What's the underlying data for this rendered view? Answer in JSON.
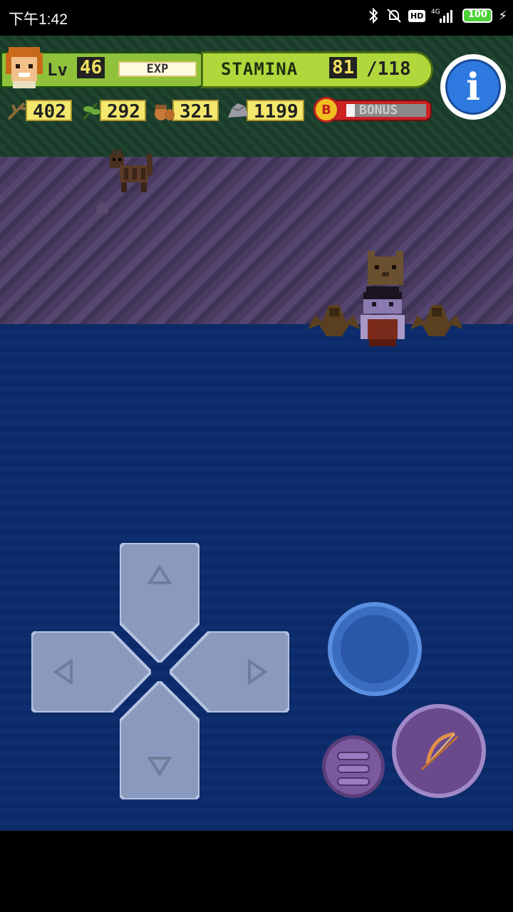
{
  "status_bar": {
    "time": "下午1:42",
    "battery": "100",
    "network": "4G",
    "hd": "HD"
  },
  "hud": {
    "level_label": "Lv",
    "level": "46",
    "exp_label": "EXP",
    "stamina_label": "STAMINA",
    "stamina_current": "81",
    "stamina_separator": "/",
    "stamina_max": "118",
    "info_label": "i",
    "resources": {
      "wood": "402",
      "herb": "292",
      "acorn": "321",
      "stone": "1199"
    },
    "bonus_label": "BONUS",
    "bonus_coin": "B"
  },
  "colors": {
    "ground": "#4a3c60",
    "water": "#0d2a66",
    "accent_blue": "#2f7ae0",
    "dpad": "#98a6c8"
  },
  "controls": {
    "dpad": [
      "up",
      "down",
      "left",
      "right"
    ],
    "action_button": "action",
    "menu_button": "menu",
    "bow_button": "bow"
  }
}
